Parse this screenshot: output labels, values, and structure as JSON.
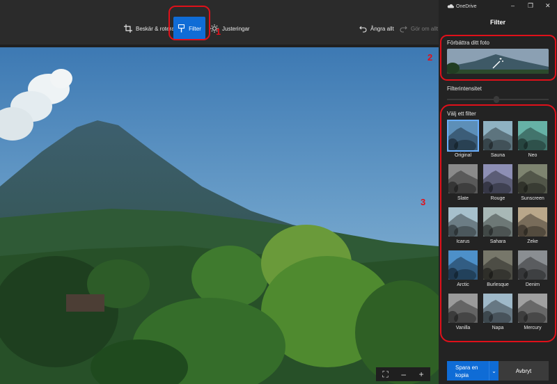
{
  "window": {
    "app_name": "OneDrive",
    "minimize_icon": "minimize-icon",
    "restore_icon": "restore-icon",
    "close_icon": "close-icon"
  },
  "toolbar": {
    "crop_label": "Beskär & rotera",
    "filter_label": "Filter",
    "adjust_label": "Justeringar",
    "undo_label": "Ångra allt",
    "redo_label": "Gör om allt"
  },
  "zoom": {
    "fit": "⛶",
    "zoom_out": "–",
    "zoom_in": "+"
  },
  "panel": {
    "title": "Filter",
    "enhance_label": "Förbättra ditt foto",
    "intensity_label": "Filterintensitet",
    "choose_label": "Välj ett filter",
    "filters": [
      {
        "name": "Original",
        "tone": "#5d8fb8",
        "selected": true
      },
      {
        "name": "Sauna",
        "tone": "#8fb2c2"
      },
      {
        "name": "Neo",
        "tone": "#66b2a6"
      },
      {
        "name": "Slate",
        "tone": "#8a8a8a"
      },
      {
        "name": "Rouge",
        "tone": "#8d8fb5"
      },
      {
        "name": "Sunscreen",
        "tone": "#7e8470"
      },
      {
        "name": "Icarus",
        "tone": "#a6c0cc"
      },
      {
        "name": "Sahara",
        "tone": "#a8b8b6"
      },
      {
        "name": "Zeke",
        "tone": "#b9a78a"
      },
      {
        "name": "Arctic",
        "tone": "#4d90c9"
      },
      {
        "name": "Burlesque",
        "tone": "#77776a"
      },
      {
        "name": "Denim",
        "tone": "#8a8e92"
      },
      {
        "name": "Vanilla",
        "tone": "#9a9a9a"
      },
      {
        "name": "Napa",
        "tone": "#9fb9c9"
      },
      {
        "name": "Mercury",
        "tone": "#a0a0a0"
      }
    ],
    "save_label_line1": "Spara en",
    "save_label_line2": "kopia",
    "cancel_label": "Avbryt"
  },
  "annotations": [
    "1",
    "2",
    "3"
  ],
  "colors": {
    "accent": "#0f6cd6",
    "annotation": "#e0101a"
  }
}
